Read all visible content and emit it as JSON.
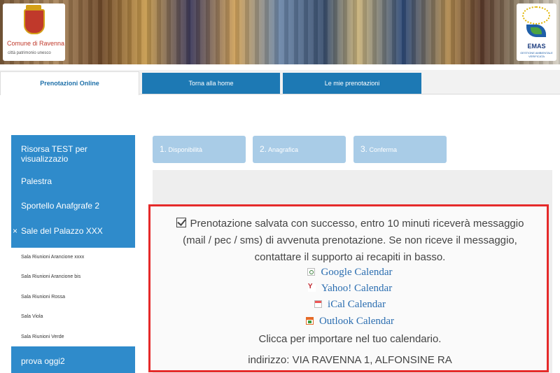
{
  "header": {
    "logo_city": "Comune di Ravenna",
    "logo_sub": "città patrimonio  unesco",
    "emas_title": "EMAS",
    "emas_sub": "GESTIONE AMBIENTALE VERIFICATA"
  },
  "tabs": [
    {
      "label": "Prenotazioni Online",
      "active": true
    },
    {
      "label": "Torna alla home",
      "active": false
    },
    {
      "label": "Le mie prenotazioni",
      "active": false
    }
  ],
  "sidebar": {
    "items": [
      {
        "label": "Risorsa TEST per visualizzazio"
      },
      {
        "label": "Palestra"
      },
      {
        "label": "Sportello Anafgrafe 2"
      },
      {
        "label": "Sale del Palazzo XXX",
        "expanded": true,
        "marker": "×"
      }
    ],
    "subitems": [
      {
        "label": "Sala Riunioni Arancione xxxx"
      },
      {
        "label": "Sala Riunioni Arancione bis"
      },
      {
        "label": "Sala Riunioni Rossa"
      },
      {
        "label": "Sala Viola"
      },
      {
        "label": "Sala Riunioni Verde"
      }
    ],
    "bottom_item": {
      "label": "prova oggi2"
    }
  },
  "steps": [
    {
      "num": "1.",
      "label": "Disponibilità"
    },
    {
      "num": "2.",
      "label": "Anagrafica"
    },
    {
      "num": "3.",
      "label": "Conferma"
    }
  ],
  "confirmation": {
    "line1": "Prenotazione salvata con successo, entro 10 minuti riceverà messaggio",
    "line2": "(mail / pec / sms) di avvenuta prenotazione. Se non riceve il messaggio,",
    "line3": "contattare il supporto ai recapiti in basso.",
    "calendars": [
      {
        "label": "Google Calendar",
        "icon": "google-calendar-icon"
      },
      {
        "label": "Yahoo! Calendar",
        "icon": "yahoo-calendar-icon"
      },
      {
        "label": "iCal Calendar",
        "icon": "ical-calendar-icon"
      },
      {
        "label": "Outlook Calendar",
        "icon": "outlook-calendar-icon"
      }
    ],
    "import_text": "Clicca per importare nel tuo calendario.",
    "address": "indirizzo: VIA RAVENNA 1, ALFONSINE RA"
  },
  "colors": {
    "tab_blue": "#1d79b4",
    "sidebar_blue": "#2f8bcb",
    "step_blue": "#a9cce7",
    "alert_red": "#e52a2a",
    "link_blue": "#2a6db0"
  }
}
